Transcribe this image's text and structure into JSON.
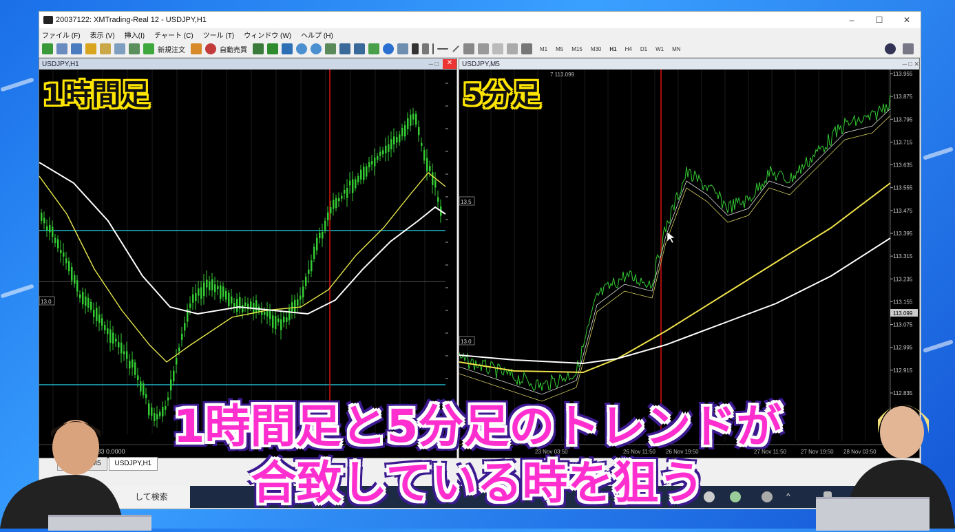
{
  "window": {
    "title": "20037122: XMTrading-Real 12 - USDJPY,H1",
    "controls": [
      "–",
      "☐",
      "✕"
    ]
  },
  "menu": [
    "ファイル (F)",
    "表示 (V)",
    "挿入(I)",
    "チャート (C)",
    "ツール (T)",
    "ウィンドウ (W)",
    "ヘルプ (H)"
  ],
  "toolbar": {
    "new_order_label": "新規注文",
    "auto_trade_label": "自動売買",
    "timeframes": [
      "M1",
      "M5",
      "M15",
      "M30",
      "H1",
      "H4",
      "D1",
      "W1",
      "MN"
    ],
    "selected_timeframe": "H1"
  },
  "chart_h1": {
    "window_title": "USDJPY,H1",
    "overlay_label": "1時間足",
    "bottom_indicator": "0.0864 -0.0583 0.0000",
    "left_level_tag": "13.0",
    "trend_direction": "up",
    "colors": {
      "candles": "#33cc33",
      "ma_fast": "#e8e84a",
      "ma_slow": "#ffffff",
      "hlines": "#1fb8c8",
      "vline": "#d11"
    }
  },
  "chart_m5": {
    "window_title": "USDJPY,M5",
    "header_text": "7 113.099",
    "left_tag_top": "13.5",
    "left_tag_bottom": "13.0",
    "price_axis": [
      "113.955",
      "113.875",
      "113.795",
      "113.715",
      "113.635",
      "113.555",
      "113.475",
      "113.395",
      "113.315",
      "113.235",
      "113.155",
      "113.075",
      "112.995",
      "112.915",
      "112.835"
    ],
    "current_price": "113.099",
    "time_axis": [
      "23 Nov 03:50",
      "26 Nov 11:50",
      "26 Nov 19:50",
      "27 Nov 11:50",
      "27 Nov 19:50",
      "28 Nov 03:50"
    ],
    "overlay_label": "5分足",
    "trend_direction": "up",
    "colors": {
      "candles": "#33cc33",
      "ma_fast": "#f0e34a",
      "ma_slow": "#ffffff",
      "vline": "#d11"
    }
  },
  "tabs": [
    "USDJPY,M5",
    "USDJPY,H1"
  ],
  "active_tab": "USDJPY,H1",
  "taskbar": {
    "search_text": "して検索"
  },
  "caption": {
    "line1": "1時間足と5分足のトレンドが",
    "line2": "合致している時を狙う"
  }
}
